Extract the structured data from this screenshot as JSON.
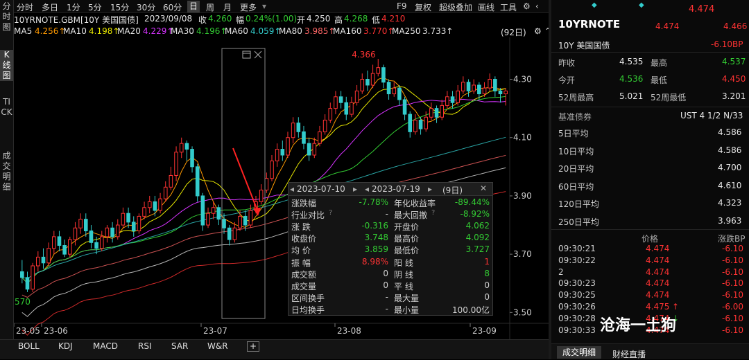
{
  "leftbar": {
    "items": [
      "分时图",
      "K线图",
      "TICK",
      "成交明细"
    ]
  },
  "toolbar": {
    "periods": [
      "分时",
      "多日",
      "1分",
      "5分",
      "15分",
      "30分",
      "60分",
      "日",
      "周",
      "月",
      "更多"
    ],
    "right": [
      "F9",
      "复权",
      "超级叠加",
      "画线",
      "工具"
    ]
  },
  "info": {
    "symbol": "10YRNOTE.GBM[10Y 美国国债]",
    "date": "2023/09/08",
    "close_label": "收",
    "close": "4.260",
    "chg_label": "幅",
    "chg": "0.24%(1.00)",
    "open_label": "开",
    "open": "4.250",
    "high_label": "高",
    "high": "4.268",
    "low_label": "低",
    "low": "4.210"
  },
  "ma": {
    "items": [
      {
        "label": "MA5",
        "value": "4.256↑",
        "color": "#ff9900"
      },
      {
        "label": "MA10",
        "value": "4.198↑",
        "color": "#e6e600"
      },
      {
        "label": "MA20",
        "value": "4.229↑",
        "color": "#d633ff"
      },
      {
        "label": "MA30",
        "value": "4.196↑",
        "color": "#33cc33"
      },
      {
        "label": "MA60",
        "value": "4.059↑",
        "color": "#33cccc"
      },
      {
        "label": "MA80",
        "value": "3.985↑",
        "color": "#ff6666"
      },
      {
        "label": "MA160",
        "value": "3.770↑",
        "color": "#ff3333"
      },
      {
        "label": "MA250",
        "value": "3.733↑",
        "color": "#e6e6e6"
      }
    ],
    "count": "(92日)"
  },
  "chart_data": {
    "type": "candlestick",
    "y_ticks": [
      "4.30",
      "4.10",
      "3.90",
      "3.70",
      "3.50"
    ],
    "x_ticks": [
      "23-05",
      "23-06",
      "23-07",
      "23-08",
      "23-09"
    ],
    "marks": {
      "high_label": "4.366",
      "low_label": "3.570"
    },
    "ylim": [
      3.47,
      4.42
    ],
    "candles": [
      [
        3.64,
        3.62,
        3.68,
        3.6
      ],
      [
        3.62,
        3.58,
        3.64,
        3.57
      ],
      [
        3.58,
        3.66,
        3.67,
        3.57
      ],
      [
        3.66,
        3.69,
        3.71,
        3.64
      ],
      [
        3.69,
        3.67,
        3.72,
        3.65
      ],
      [
        3.67,
        3.72,
        3.74,
        3.66
      ],
      [
        3.72,
        3.76,
        3.78,
        3.7
      ],
      [
        3.76,
        3.73,
        3.78,
        3.71
      ],
      [
        3.73,
        3.7,
        3.75,
        3.69
      ],
      [
        3.7,
        3.75,
        3.76,
        3.69
      ],
      [
        3.75,
        3.79,
        3.81,
        3.73
      ],
      [
        3.79,
        3.82,
        3.84,
        3.77
      ],
      [
        3.82,
        3.78,
        3.84,
        3.76
      ],
      [
        3.78,
        3.74,
        3.8,
        3.72
      ],
      [
        3.74,
        3.72,
        3.76,
        3.7
      ],
      [
        3.72,
        3.76,
        3.78,
        3.71
      ],
      [
        3.76,
        3.79,
        3.8,
        3.74
      ],
      [
        3.79,
        3.76,
        3.81,
        3.74
      ],
      [
        3.76,
        3.8,
        3.82,
        3.75
      ],
      [
        3.8,
        3.84,
        3.86,
        3.79
      ],
      [
        3.84,
        3.81,
        3.86,
        3.79
      ],
      [
        3.81,
        3.78,
        3.83,
        3.76
      ],
      [
        3.78,
        3.83,
        3.84,
        3.77
      ],
      [
        3.83,
        3.86,
        3.88,
        3.82
      ],
      [
        3.86,
        3.88,
        3.9,
        3.84
      ],
      [
        3.88,
        3.85,
        3.9,
        3.83
      ],
      [
        3.85,
        3.89,
        3.91,
        3.84
      ],
      [
        3.89,
        3.93,
        3.95,
        3.88
      ],
      [
        3.93,
        3.97,
        4.0,
        3.92
      ],
      [
        3.97,
        4.05,
        4.07,
        3.95
      ],
      [
        4.05,
        4.08,
        4.1,
        4.03
      ],
      [
        4.08,
        4.06,
        4.09,
        4.02
      ],
      [
        4.06,
        4.0,
        4.07,
        3.98
      ],
      [
        4.0,
        3.9,
        4.01,
        3.88
      ],
      [
        3.9,
        3.8,
        3.91,
        3.78
      ],
      [
        3.8,
        3.84,
        3.86,
        3.79
      ],
      [
        3.84,
        3.86,
        3.88,
        3.82
      ],
      [
        3.86,
        3.82,
        3.87,
        3.8
      ],
      [
        3.82,
        3.79,
        3.84,
        3.77
      ],
      [
        3.79,
        3.75,
        3.8,
        3.73
      ],
      [
        3.75,
        3.79,
        3.81,
        3.74
      ],
      [
        3.79,
        3.83,
        3.85,
        3.78
      ],
      [
        3.83,
        3.8,
        3.85,
        3.78
      ],
      [
        3.8,
        3.85,
        3.87,
        3.79
      ],
      [
        3.85,
        3.88,
        3.9,
        3.84
      ],
      [
        3.88,
        3.92,
        3.94,
        3.87
      ],
      [
        3.92,
        3.96,
        3.98,
        3.91
      ],
      [
        3.96,
        4.02,
        4.04,
        3.95
      ],
      [
        4.02,
        4.06,
        4.08,
        4.0
      ],
      [
        4.06,
        4.04,
        4.09,
        4.02
      ],
      [
        4.04,
        4.1,
        4.12,
        4.03
      ],
      [
        4.1,
        4.15,
        4.17,
        4.08
      ],
      [
        4.15,
        4.12,
        4.17,
        4.1
      ],
      [
        4.12,
        4.08,
        4.14,
        4.06
      ],
      [
        4.08,
        4.04,
        4.1,
        4.02
      ],
      [
        4.04,
        4.08,
        4.1,
        4.03
      ],
      [
        4.08,
        4.12,
        4.14,
        4.07
      ],
      [
        4.12,
        4.16,
        4.18,
        4.11
      ],
      [
        4.16,
        4.2,
        4.22,
        4.15
      ],
      [
        4.2,
        4.24,
        4.26,
        4.18
      ],
      [
        4.24,
        4.22,
        4.26,
        4.2
      ],
      [
        4.22,
        4.18,
        4.24,
        4.16
      ],
      [
        4.18,
        4.22,
        4.24,
        4.17
      ],
      [
        4.22,
        4.26,
        4.28,
        4.21
      ],
      [
        4.26,
        4.3,
        4.32,
        4.25
      ],
      [
        4.3,
        4.28,
        4.33,
        4.26
      ],
      [
        4.28,
        4.32,
        4.35,
        4.27
      ],
      [
        4.32,
        4.34,
        4.37,
        4.31
      ],
      [
        4.34,
        4.29,
        4.35,
        4.27
      ],
      [
        4.29,
        4.25,
        4.3,
        4.23
      ],
      [
        4.25,
        4.27,
        4.29,
        4.24
      ],
      [
        4.27,
        4.23,
        4.28,
        4.21
      ],
      [
        4.23,
        4.18,
        4.24,
        4.16
      ],
      [
        4.18,
        4.12,
        4.19,
        4.1
      ],
      [
        4.12,
        4.16,
        4.18,
        4.11
      ],
      [
        4.16,
        4.13,
        4.17,
        4.11
      ],
      [
        4.13,
        4.17,
        4.19,
        4.12
      ],
      [
        4.17,
        4.2,
        4.22,
        4.16
      ],
      [
        4.2,
        4.17,
        4.21,
        4.15
      ],
      [
        4.17,
        4.21,
        4.23,
        4.16
      ],
      [
        4.21,
        4.24,
        4.26,
        4.2
      ],
      [
        4.24,
        4.22,
        4.26,
        4.2
      ],
      [
        4.22,
        4.26,
        4.28,
        4.21
      ],
      [
        4.26,
        4.29,
        4.31,
        4.25
      ],
      [
        4.29,
        4.26,
        4.3,
        4.24
      ],
      [
        4.26,
        4.28,
        4.3,
        4.25
      ],
      [
        4.28,
        4.25,
        4.29,
        4.23
      ],
      [
        4.25,
        4.27,
        4.29,
        4.24
      ],
      [
        4.27,
        4.3,
        4.32,
        4.26
      ],
      [
        4.3,
        4.26,
        4.31,
        4.24
      ],
      [
        4.26,
        4.25,
        4.27,
        4.22
      ],
      [
        4.25,
        4.26,
        4.27,
        4.21
      ]
    ]
  },
  "popup": {
    "date1": "2023-07-10",
    "date2": "2023-07-19",
    "days": "(9日)",
    "rows": [
      {
        "l1": "涨跌幅",
        "v1": "-7.78%",
        "c1": "#33cc33",
        "l2": "年化收益率",
        "v2": "-89.44%",
        "c2": "#33cc33"
      },
      {
        "l1": "行业对比",
        "v1": "-",
        "c1": "#d0d0d0",
        "l2": "最大回撤",
        "v2": "-8.92%",
        "c2": "#33cc33",
        "q": true
      },
      {
        "l1": "涨  跌",
        "v1": "-0.316",
        "c1": "#33cc33",
        "l2": "开盘价",
        "v2": "4.062",
        "c2": "#33cc33"
      },
      {
        "l1": "收盘价",
        "v1": "3.748",
        "c1": "#33cc33",
        "l2": "最高价",
        "v2": "4.092",
        "c2": "#33cc33"
      },
      {
        "l1": "均  价",
        "v1": "3.859",
        "c1": "#33cc33",
        "l2": "最低价",
        "v2": "3.727",
        "c2": "#33cc33"
      },
      {
        "l1": "振  幅",
        "v1": "8.98%",
        "c1": "#ff3333",
        "l2": "阳  线",
        "v2": "1",
        "c2": "#ff3333"
      },
      {
        "l1": "成交额",
        "v1": "0",
        "c1": "#d0d0d0",
        "l2": "阴  线",
        "v2": "8",
        "c2": "#33cc33"
      },
      {
        "l1": "成交量",
        "v1": "0",
        "c1": "#d0d0d0",
        "l2": "平  线",
        "v2": "0",
        "c2": "#d0d0d0"
      },
      {
        "l1": "区间换手",
        "v1": "-",
        "c1": "#d0d0d0",
        "l2": "最大量",
        "v2": "0",
        "c2": "#d0d0d0"
      },
      {
        "l1": "日均换手",
        "v1": "-",
        "c1": "#d0d0d0",
        "l2": "最小量",
        "v2": "100.00亿",
        "c2": "#d0d0d0"
      }
    ]
  },
  "bottombar": {
    "tabs": [
      "BOLL",
      "KDJ",
      "MACD",
      "RSI",
      "SAR",
      "W&R"
    ]
  },
  "right": {
    "price_top": "4.474",
    "code": "10YRNOTE",
    "price": "4.474",
    "price2": "4.466",
    "name": "10Y 美国国债",
    "chg": "-6.10BP",
    "rows": [
      {
        "l": "昨收",
        "v": "4.535",
        "vc": "#e6e6e6",
        "l2": "最高",
        "v2": "4.537",
        "v2c": "#33cc33"
      },
      {
        "l": "今开",
        "v": "4.536",
        "vc": "#33cc33",
        "l2": "最低",
        "v2": "4.450",
        "v2c": "#ff3333"
      },
      {
        "l": "52周最高",
        "v": "5.021",
        "vc": "#e6e6e6",
        "l2": "52周最低",
        "v2": "3.201",
        "v2c": "#e6e6e6"
      }
    ],
    "bond_label": "基准债券",
    "bond": "UST 4 1/2 N/33",
    "avgs": [
      {
        "l": "5日平均",
        "v": "4.586"
      },
      {
        "l": "10日平均",
        "v": "4.586"
      },
      {
        "l": "20日平均",
        "v": "4.700"
      },
      {
        "l": "60日平均",
        "v": "4.610"
      },
      {
        "l": "120日平均",
        "v": "4.323"
      },
      {
        "l": "250日平均",
        "v": "3.963"
      }
    ],
    "ticks_head": {
      "price": "价格",
      "chg": "涨跌BP"
    },
    "ticks": [
      {
        "t": "09:30:21",
        "p": "4.474",
        "c": "-6.10",
        "arr": ""
      },
      {
        "t": "09:30:22",
        "p": "4.474",
        "c": "-6.10",
        "arr": ""
      },
      {
        "t": "2",
        "p": "4.474",
        "c": "-6.10",
        "arr": ""
      },
      {
        "t": "09:30:23",
        "p": "4.474",
        "c": "-6.10",
        "arr": ""
      },
      {
        "t": "09:30:25",
        "p": "4.474",
        "c": "-6.10",
        "arr": ""
      },
      {
        "t": "09:30:26",
        "p": "4.475",
        "c": "-6.00",
        "arr": "up"
      },
      {
        "t": "09:30:28",
        "p": "4.474",
        "c": "-6.10",
        "arr": "down"
      },
      {
        "t": "09:30:33",
        "p": "4.474",
        "c": "-6.10",
        "arr": ""
      }
    ],
    "tabs": [
      "成交明细",
      "财经直播"
    ]
  },
  "watermark": "沧海一土狗"
}
